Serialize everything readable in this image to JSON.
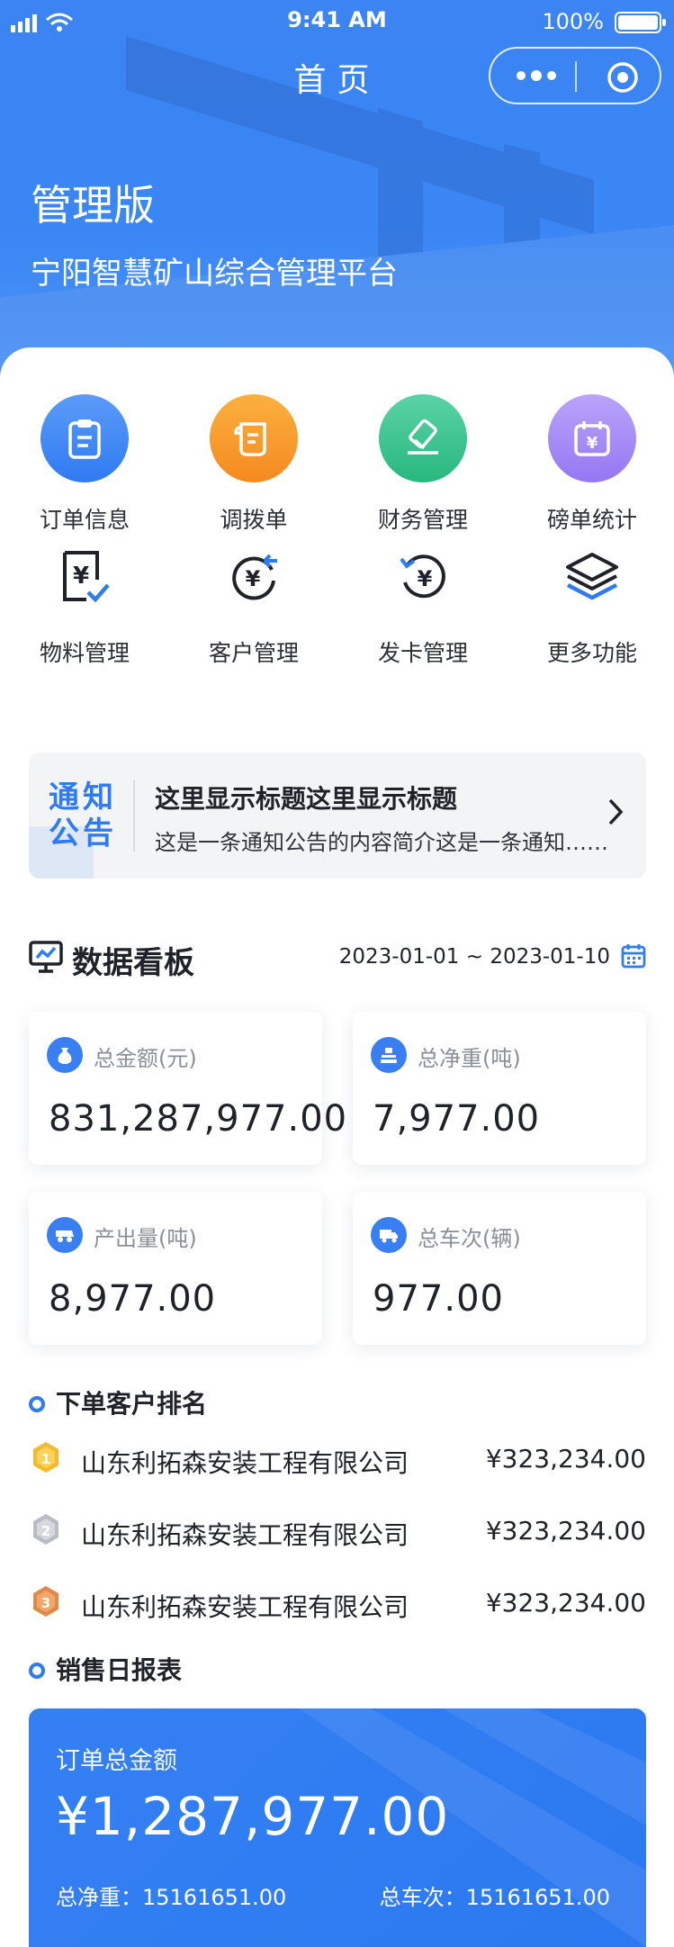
{
  "status_bar": {
    "time": "9:41 AM",
    "battery": "100%"
  },
  "nav": {
    "title": "首页"
  },
  "hero": {
    "title": "管理版",
    "subtitle": "宁阳智慧矿山综合管理平台"
  },
  "quick_menu": [
    {
      "label": "订单信息",
      "icon": "clipboard-icon",
      "color": "#3b82f6"
    },
    {
      "label": "调拨单",
      "icon": "scroll-icon",
      "color": "#f59e0b"
    },
    {
      "label": "财务管理",
      "icon": "eraser-icon",
      "color": "#34c38f"
    },
    {
      "label": "磅单统计",
      "icon": "calendar-yen-icon",
      "color": "#a78bfa"
    },
    {
      "label": "物料管理",
      "icon": "yen-doc-icon"
    },
    {
      "label": "客户管理",
      "icon": "yen-refresh-icon"
    },
    {
      "label": "发卡管理",
      "icon": "yen-rotate-icon"
    },
    {
      "label": "更多功能",
      "icon": "layers-icon"
    }
  ],
  "notice": {
    "tag_line1": "通知",
    "tag_line2": "公告",
    "title": "这里显示标题这里显示标题",
    "desc": "这是一条通知公告的内容简介这是一条通知……"
  },
  "dashboard": {
    "title": "数据看板",
    "date_range": "2023-01-01 ~ 2023-01-10",
    "stats": [
      {
        "name": "总金额(元)",
        "value": "831,287,977.00",
        "icon": "money-bag-icon"
      },
      {
        "name": "总净重(吨)",
        "value": "7,977.00",
        "icon": "scale-icon"
      },
      {
        "name": "产出量(吨)",
        "value": "8,977.00",
        "icon": "truck-icon"
      },
      {
        "name": "总车次(辆)",
        "value": "977.00",
        "icon": "truck-side-icon"
      }
    ]
  },
  "ranking": {
    "title": "下单客户排名",
    "items": [
      {
        "rank": "1",
        "name": "山东利拓森安装工程有限公司",
        "amount": "¥323,234.00",
        "color": "#f5b82e"
      },
      {
        "rank": "2",
        "name": "山东利拓森安装工程有限公司",
        "amount": "¥323,234.00",
        "color": "#b8bcc4"
      },
      {
        "rank": "3",
        "name": "山东利拓森安装工程有限公司",
        "amount": "¥323,234.00",
        "color": "#e08a4a"
      }
    ]
  },
  "sales_report": {
    "title": "销售日报表",
    "card_title": "订单总金额",
    "total": "¥1,287,977.00",
    "net_weight": "总净重：15161651.00",
    "trips": "总车次：15161651.00"
  }
}
